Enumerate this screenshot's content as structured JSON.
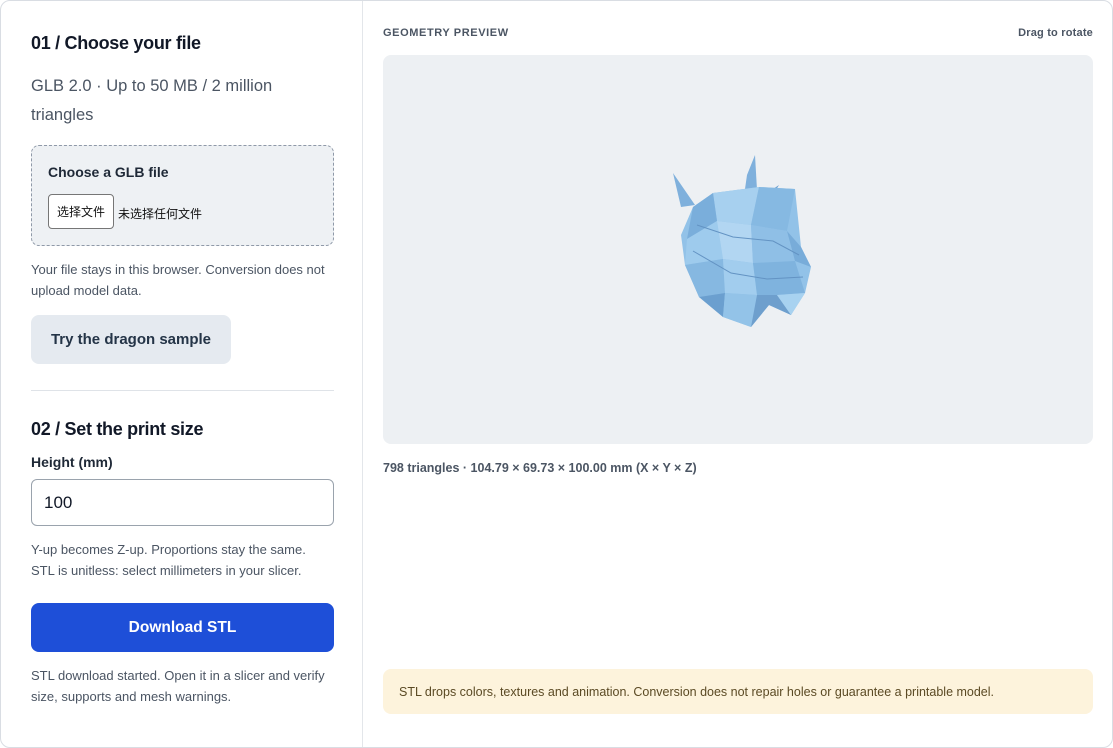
{
  "step1": {
    "heading": "01 / Choose your file",
    "subtitle": "GLB 2.0 · Up to 50 MB / 2 million triangles",
    "dropzone_label": "Choose a GLB file",
    "file_button": "选择文件",
    "file_status": "未选择任何文件",
    "privacy_note": "Your file stays in this browser. Conversion does not upload model data.",
    "sample_button": "Try the dragon sample"
  },
  "step2": {
    "heading": "02 / Set the print size",
    "height_label": "Height (mm)",
    "height_value": "100",
    "axis_note": "Y-up becomes Z-up. Proportions stay the same. STL is unitless: select millimeters in your slicer.",
    "download_button": "Download STL",
    "download_status": "STL download started. Open it in a slicer and verify size, supports and mesh warnings."
  },
  "preview": {
    "title": "GEOMETRY PREVIEW",
    "hint": "Drag to rotate",
    "stats": "798 triangles · 104.79 × 69.73 × 100.00 mm (X × Y × Z)",
    "warning": "STL drops colors, textures and animation. Conversion does not repair holes or guarantee a printable model."
  },
  "colors": {
    "accent": "#1e4fd8",
    "model": "#8fbfe6",
    "viewport_bg": "#edf0f3",
    "warning_bg": "#fdf3dc"
  }
}
